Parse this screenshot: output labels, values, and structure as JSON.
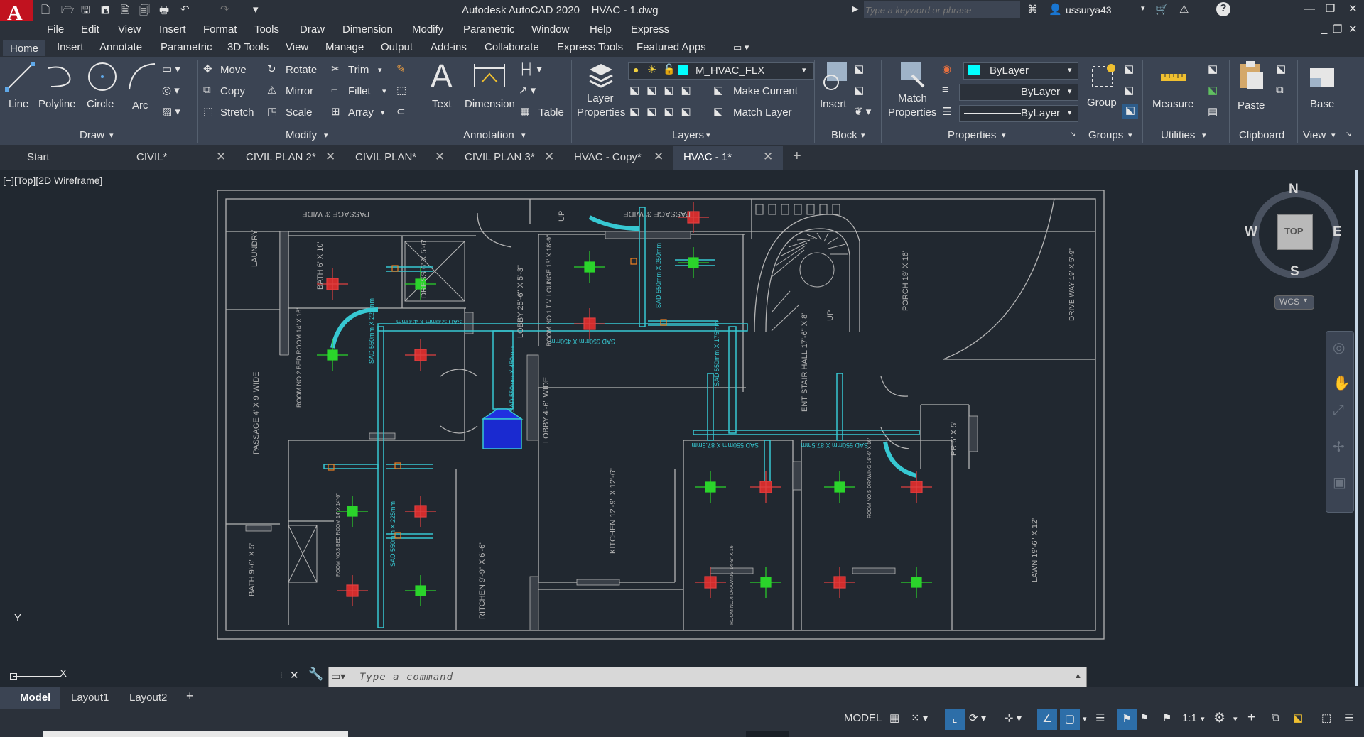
{
  "window": {
    "title": "Autodesk AutoCAD 2020    HVAC - 1.dwg",
    "search_placeholder": "Type a keyword or phrase",
    "user": "ussurya43"
  },
  "menubar": [
    "File",
    "Edit",
    "View",
    "Insert",
    "Format",
    "Tools",
    "Draw",
    "Dimension",
    "Modify",
    "Parametric",
    "Window",
    "Help",
    "Express"
  ],
  "ribbon_tabs": [
    "Home",
    "Insert",
    "Annotate",
    "Parametric",
    "3D Tools",
    "View",
    "Manage",
    "Output",
    "Add-ins",
    "Collaborate",
    "Express Tools",
    "Featured Apps"
  ],
  "ribbon": {
    "draw": {
      "line": "Line",
      "polyline": "Polyline",
      "circle": "Circle",
      "arc": "Arc",
      "panel": "Draw"
    },
    "modify": {
      "move": "Move",
      "rotate": "Rotate",
      "trim": "Trim",
      "copy": "Copy",
      "mirror": "Mirror",
      "fillet": "Fillet",
      "stretch": "Stretch",
      "scale": "Scale",
      "array": "Array",
      "panel": "Modify"
    },
    "annotation": {
      "text": "Text",
      "dimension": "Dimension",
      "table": "Table",
      "panel": "Annotation"
    },
    "layers": {
      "layer_properties_1": "Layer",
      "layer_properties_2": "Properties",
      "current_layer": "M_HVAC_FLX",
      "make_current": "Make Current",
      "match_layer": "Match Layer",
      "panel": "Layers"
    },
    "block": {
      "insert": "Insert",
      "panel": "Block"
    },
    "properties": {
      "match_1": "Match",
      "match_2": "Properties",
      "color": "ByLayer",
      "linetype": "ByLayer",
      "lineweight": "ByLayer",
      "panel": "Properties"
    },
    "groups": {
      "group": "Group",
      "panel": "Groups"
    },
    "utilities": {
      "measure": "Measure",
      "panel": "Utilities"
    },
    "clipboard": {
      "paste": "Paste",
      "panel": "Clipboard"
    },
    "view": {
      "base": "Base",
      "panel": "View"
    }
  },
  "doc_tabs": [
    "Start",
    "CIVIL*",
    "CIVIL PLAN 2*",
    "CIVIL PLAN*",
    "CIVIL PLAN 3*",
    "HVAC - Copy*",
    "HVAC - 1*"
  ],
  "viewport_label": "[−][Top][2D Wireframe]",
  "viewcube": {
    "n": "N",
    "s": "S",
    "e": "E",
    "w": "W",
    "top": "TOP",
    "wcs": "WCS"
  },
  "ucs": {
    "x": "X",
    "y": "Y"
  },
  "drawing_labels": {
    "passage_top_left": "PASSAGE 3' WIDE",
    "passage_top_right": "PASSAGE 3' WIDE",
    "laundry": "LAUNDRY",
    "bath1": "BATH 6' X 10'",
    "dress": "DRESS 6' X 5'-6\"",
    "passage_left": "PASSAGE 4' X 9' WIDE",
    "lobby_vertical": "LOBBY 25'-6\" X 5'-3\"",
    "room1": "ROOM NO.1 T.V. LOUNGE 13' X 18'-9\"",
    "room2": "ROOM NO.2 BED ROOM 14' X 16'",
    "porch": "PORCH 19' X 16'",
    "driveway": "DRIVE WAY 19' X 5'-9\"",
    "stair_hall": "ENT STAIR HALL 17'-6\" X 8'",
    "lobby2": "LOBBY 4'-6\" WIDE",
    "kitchen": "KITCHEN 12'-9\" X 12'-6\"",
    "ritchen": "RITCHEN 9'-9\" X 6'-6\"",
    "pr": "PR 6' X 5'",
    "lawn": "LAWN 19'-6\" X 12'",
    "bath2": "BATH 9'-6\" X 5'",
    "room3": "ROOM NO.3 BED ROOM 14' X 14'-6\"",
    "room4": "ROOM NO.4 DRAWING 14'-9\" X 16'",
    "room5": "ROOM NO.5 DRAWING 16'-6\" X 16'",
    "up1": "UP",
    "up2": "UP",
    "sad1": "SAD 550mm X 225mm",
    "sad2": "SAD 550mm X 450mm",
    "sad3": "SAD 550mm X 450mm",
    "sad4": "SAD 550mm X 250mm",
    "sad5": "SAD 550mm X 450mm",
    "sad6": "SAD 550mm X 175mm",
    "sad7": "SAD 550mm X 225mm",
    "sad8": "SAD 550mm X 87.5mm",
    "sad9": "SAD 550mm X 87.5mm"
  },
  "command": {
    "placeholder": "Type a command"
  },
  "layout_tabs": [
    "Model",
    "Layout1",
    "Layout2"
  ],
  "status": {
    "model": "MODEL",
    "scale": "1:1"
  },
  "colors": {
    "duct": "#37c8d2",
    "grille_red": "#d22d2d",
    "grille_green": "#2bd42b",
    "wall": "#b4b4b4",
    "ahu": "#2030e0",
    "accent_red": "#d3001f"
  }
}
